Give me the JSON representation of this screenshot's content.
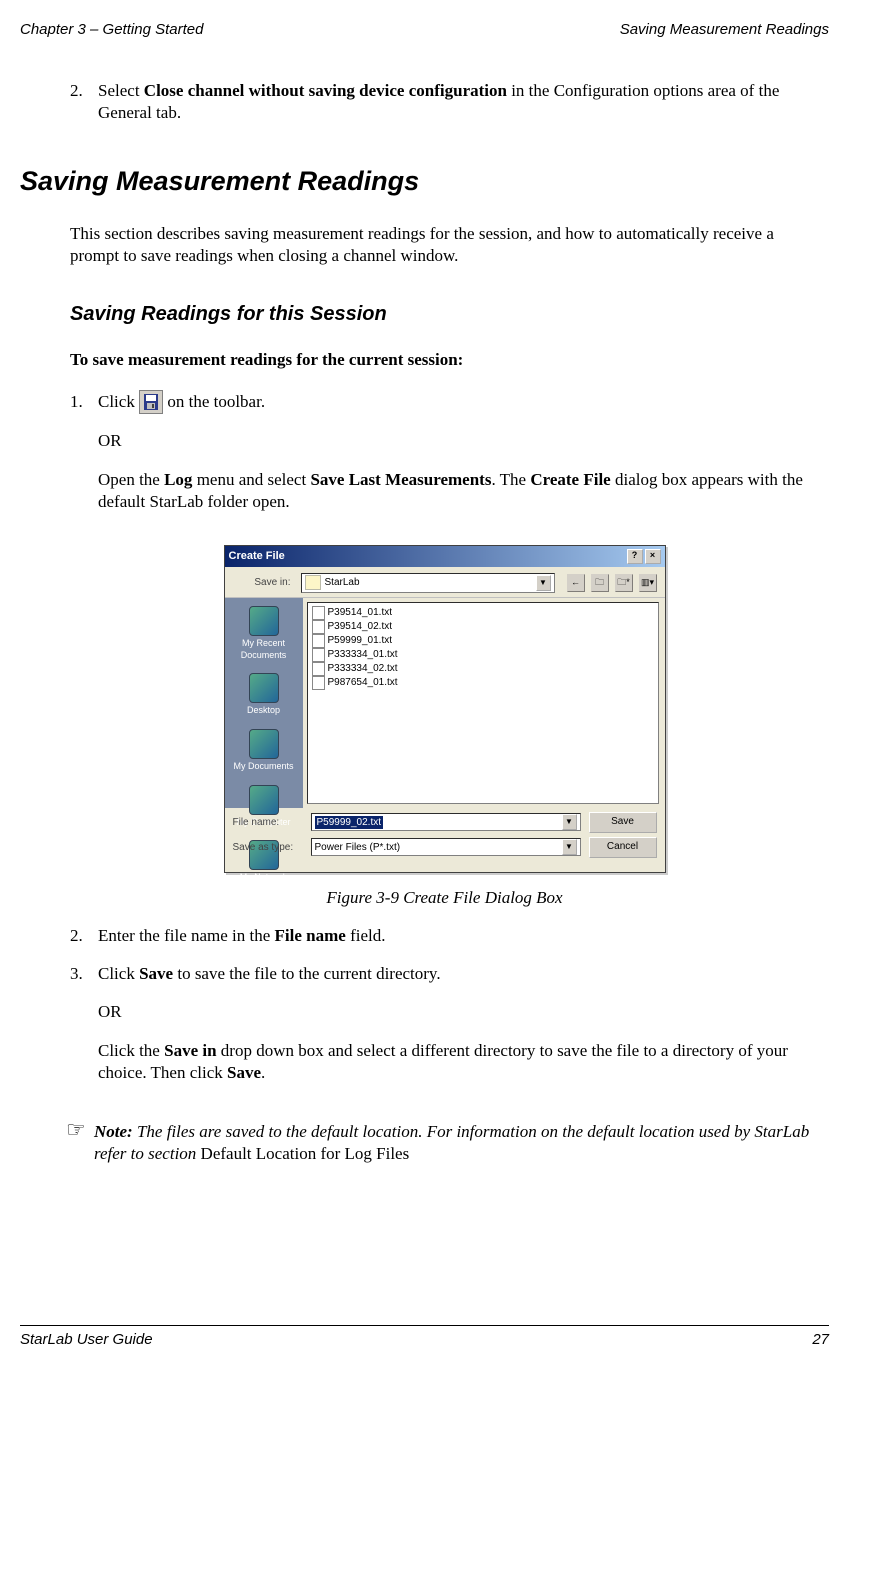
{
  "header": {
    "left": "Chapter 3 – Getting Started",
    "right": "Saving Measurement Readings"
  },
  "intro_step": {
    "num": "2.",
    "pre": "Select ",
    "bold": "Close channel without saving device configuration",
    "post": " in the Configuration options area of the General tab."
  },
  "h1": "Saving Measurement Readings",
  "intro_para": "This section describes saving measurement readings for the session, and how to automatically receive a prompt to save readings when closing a channel window.",
  "h2": "Saving Readings for this Session",
  "subhead": "To save measurement readings for the current session:",
  "step1": {
    "num": "1.",
    "pre": "Click ",
    "post": " on the toolbar.",
    "or": "OR",
    "p2a": "Open the ",
    "p2b": "Log",
    "p2c": " menu and select ",
    "p2d": "Save Last Measurements",
    "p2e": ". The ",
    "p2f": "Create File",
    "p2g": " dialog box appears with the default StarLab folder open."
  },
  "dialog": {
    "title": "Create File",
    "help": "?",
    "close": "×",
    "save_in_label": "Save in:",
    "folder": "StarLab",
    "back": "←",
    "up": "🗀",
    "new": "🗀*",
    "view": "▥▾",
    "places": [
      "My Recent Documents",
      "Desktop",
      "My Documents",
      "My Computer",
      "My Network Places"
    ],
    "files": [
      "P39514_01.txt",
      "P39514_02.txt",
      "P59999_01.txt",
      "P333334_01.txt",
      "P333334_02.txt",
      "P987654_01.txt"
    ],
    "file_name_label": "File name:",
    "file_name_value": "P59999_02.txt",
    "save_type_label": "Save as type:",
    "save_type_value": "Power Files (P*.txt)",
    "save_btn": "Save",
    "cancel_btn": "Cancel"
  },
  "caption": "Figure 3-9 Create File Dialog Box",
  "step2": {
    "num": "2.",
    "a": "Enter the file name in the ",
    "b": "File name",
    "c": " field."
  },
  "step3": {
    "num": "3.",
    "a": "Click ",
    "b": "Save",
    "c": " to save the file to the current directory.",
    "or": "OR",
    "d": "Click the ",
    "e": "Save in",
    "f": " drop down box and select a different directory to save the file to a directory of your choice. Then click ",
    "g": "Save",
    "h": "."
  },
  "note": {
    "icon": "☞",
    "label": "Note:",
    "a": " The files are saved to the default location. For information on the default location used by StarLab refer to section ",
    "b": "Default Location for Log Files"
  },
  "footer": {
    "left": "StarLab User Guide",
    "right": "27"
  }
}
